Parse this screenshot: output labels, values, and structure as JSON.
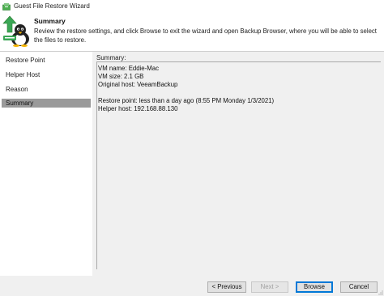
{
  "window": {
    "title": "Guest File Restore Wizard",
    "icon": "restore-app-icon"
  },
  "header": {
    "step_title": "Summary",
    "step_description": "Review the restore settings, and click Browse to exit the wizard and open Backup Browser, where you will be able to select the files to restore.",
    "icon": "linux-penguin-restore-icon"
  },
  "nav": {
    "items": [
      {
        "label": "Restore Point",
        "selected": false
      },
      {
        "label": "Helper Host",
        "selected": false
      },
      {
        "label": "Reason",
        "selected": false
      },
      {
        "label": "Summary",
        "selected": true
      }
    ]
  },
  "summary": {
    "label": "Summary:",
    "lines": [
      "VM name: Eddie-Mac",
      "VM size: 2.1 GB",
      "Original host: VeeamBackup",
      "",
      "Restore point: less than a day ago (8:55 PM Monday 1/3/2021)",
      "Helper host: 192.168.88.130"
    ]
  },
  "buttons": {
    "previous": "< Previous",
    "next": "Next >",
    "browse": "Browse",
    "cancel": "Cancel"
  },
  "colors": {
    "selected_nav": "#9a9a9a",
    "panel_bg": "#f0f0f0",
    "accent": "#0078d7",
    "icon_green": "#3aa655"
  }
}
